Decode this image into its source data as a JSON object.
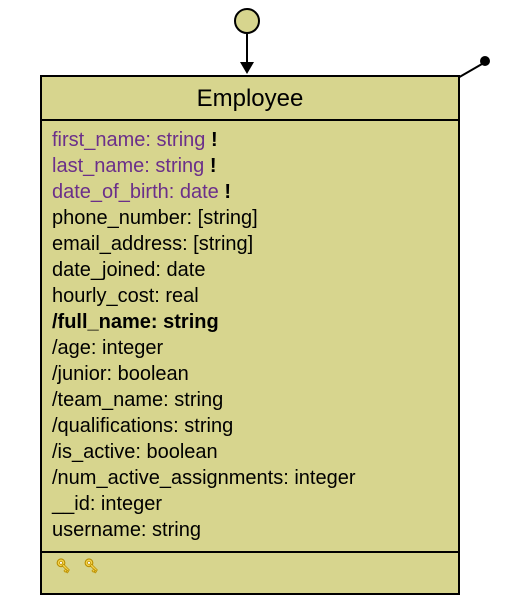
{
  "class": {
    "name": "Employee",
    "attributes": [
      {
        "text": "first_name: string ",
        "required": true,
        "bold": false
      },
      {
        "text": "last_name: string ",
        "required": true,
        "bold": false
      },
      {
        "text": "date_of_birth: date ",
        "required": true,
        "bold": false
      },
      {
        "text": "phone_number: [string]",
        "required": false,
        "bold": false
      },
      {
        "text": "email_address: [string]",
        "required": false,
        "bold": false
      },
      {
        "text": "date_joined: date",
        "required": false,
        "bold": false
      },
      {
        "text": "hourly_cost: real",
        "required": false,
        "bold": false
      },
      {
        "text": "/full_name: string",
        "required": false,
        "bold": true
      },
      {
        "text": "/age: integer",
        "required": false,
        "bold": false
      },
      {
        "text": "/junior: boolean",
        "required": false,
        "bold": false
      },
      {
        "text": "/team_name: string",
        "required": false,
        "bold": false
      },
      {
        "text": "/qualifications: string",
        "required": false,
        "bold": false
      },
      {
        "text": "/is_active: boolean",
        "required": false,
        "bold": false
      },
      {
        "text": "/num_active_assignments: integer",
        "required": false,
        "bold": false
      },
      {
        "text": "__id: integer",
        "required": false,
        "bold": false
      },
      {
        "text": "username: string",
        "required": false,
        "bold": false
      }
    ]
  },
  "bang": "!"
}
